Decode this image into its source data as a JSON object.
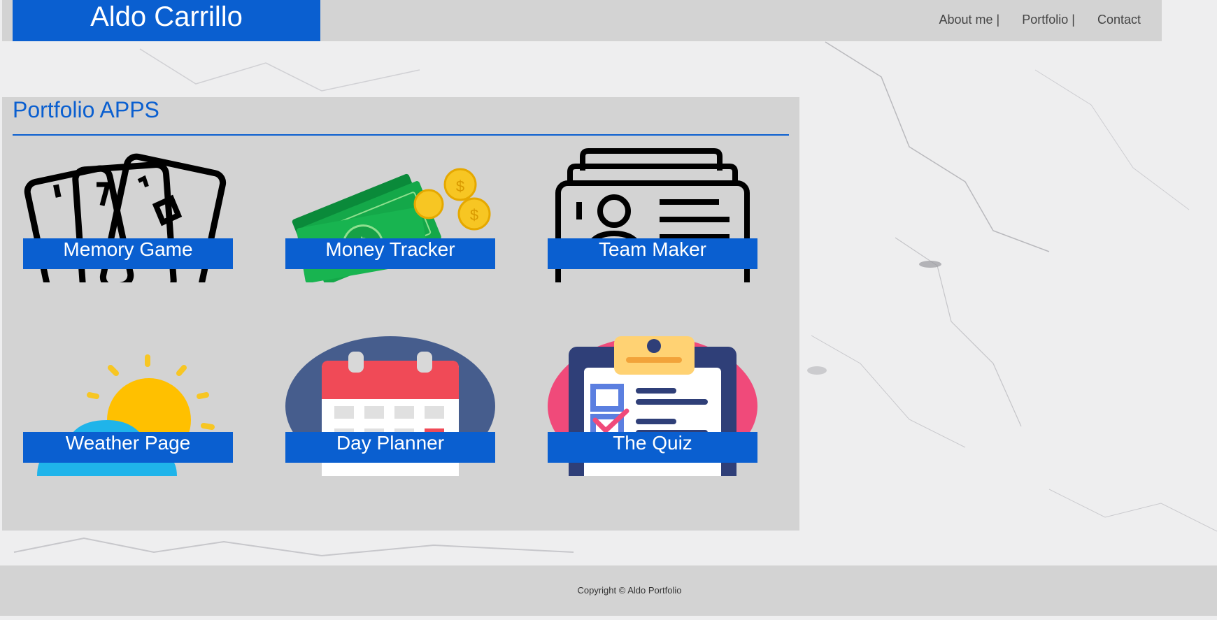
{
  "header": {
    "brand": "Aldo Carrillo",
    "nav": [
      "About me |",
      "Portfolio |",
      "Contact"
    ]
  },
  "portfolio": {
    "title": "Portfolio APPS",
    "apps": [
      {
        "label": "Memory Game",
        "icon": "playing-cards-icon"
      },
      {
        "label": "Money Tracker",
        "icon": "money-icon"
      },
      {
        "label": "Team Maker",
        "icon": "id-cards-icon"
      },
      {
        "label": "Weather Page",
        "icon": "weather-icon"
      },
      {
        "label": "Day Planner",
        "icon": "calendar-icon"
      },
      {
        "label": "The Quiz",
        "icon": "clipboard-quiz-icon"
      }
    ]
  },
  "footer": {
    "copyright": "Copyright © Aldo Portfolio"
  },
  "colors": {
    "accent": "#0a5fd0",
    "panel": "#d3d3d3",
    "background": "#eeeeef"
  }
}
